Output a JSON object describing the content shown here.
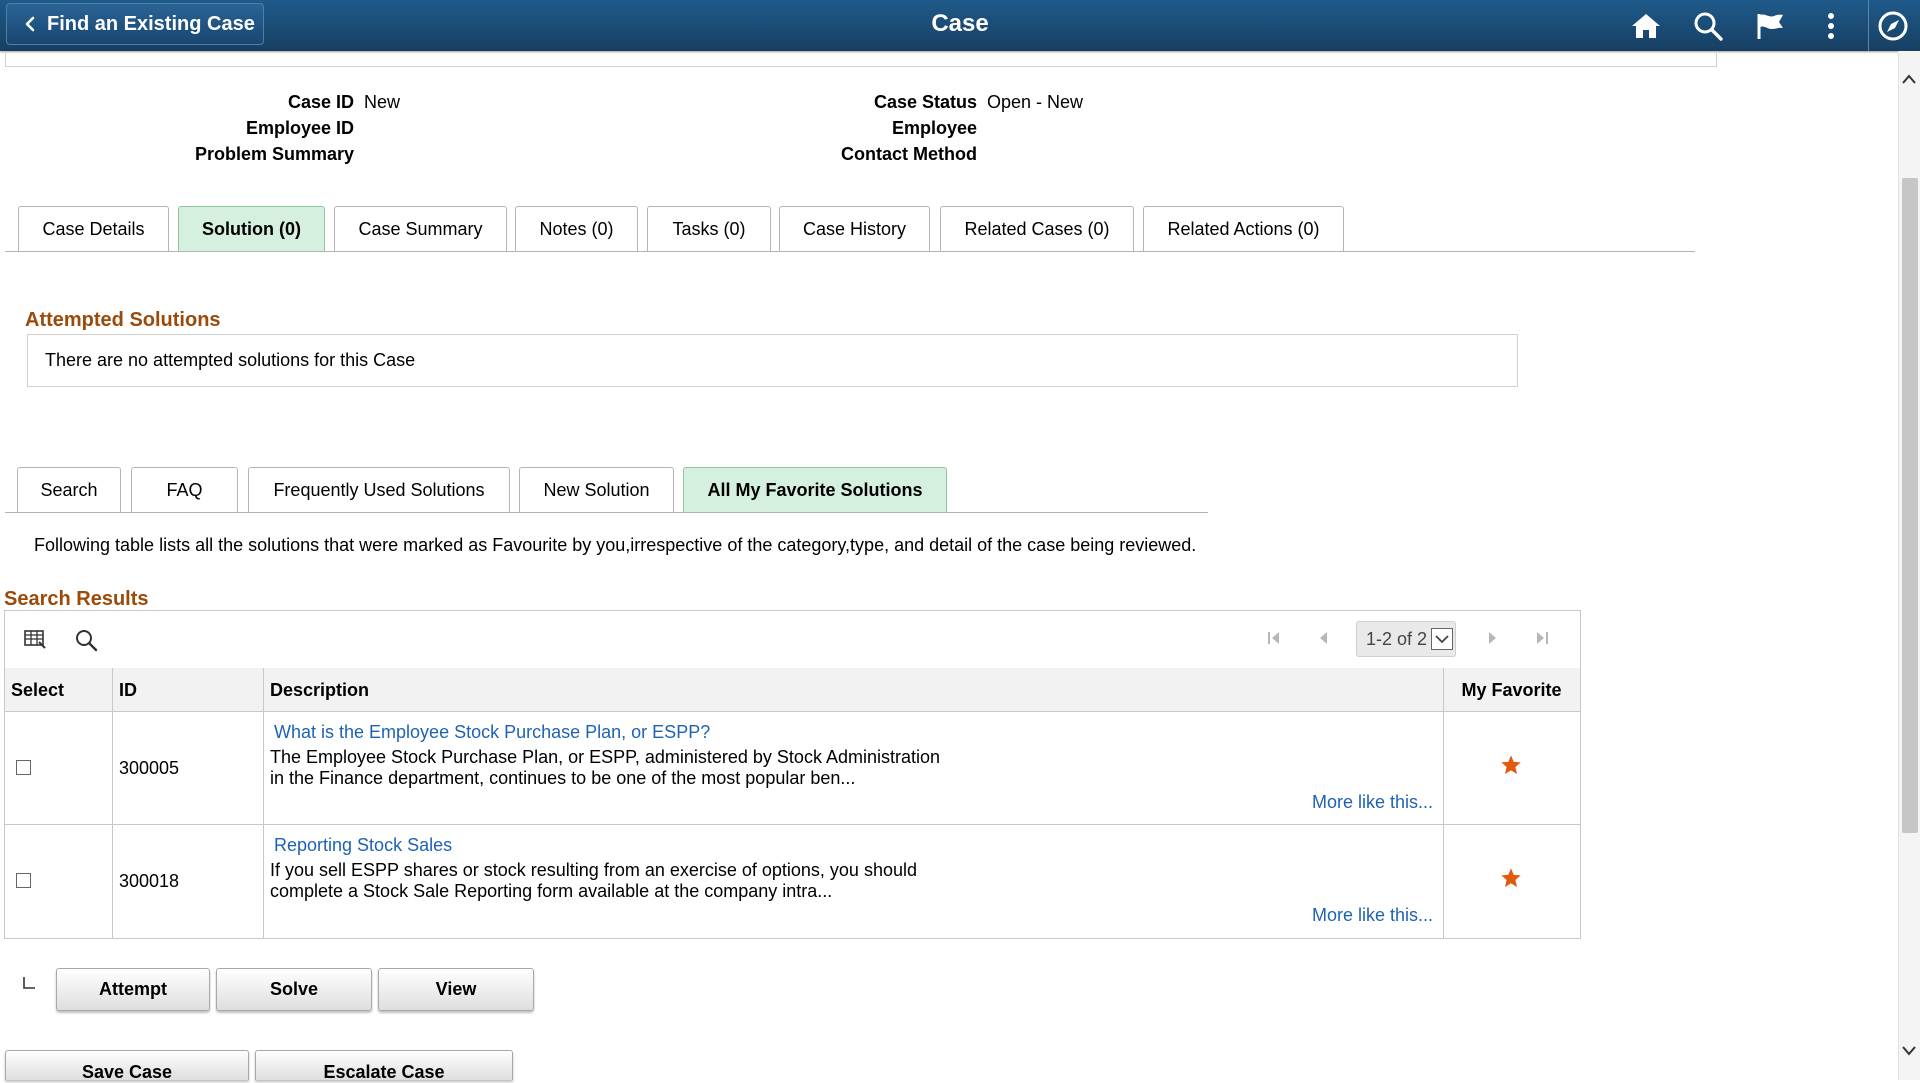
{
  "header": {
    "back_label": "Find an Existing Case",
    "title": "Case",
    "icons": [
      "home-icon",
      "search-icon",
      "flag-icon",
      "more-vertical-icon",
      "navigator-compass-icon"
    ]
  },
  "case_info": {
    "case_id_label": "Case ID",
    "case_id_value": "New",
    "employee_id_label": "Employee ID",
    "problem_summary_label": "Problem Summary",
    "case_status_label": "Case Status",
    "case_status_value": "Open - New",
    "employee_label": "Employee",
    "contact_method_label": "Contact Method"
  },
  "main_tabs": [
    {
      "label": "Case Details",
      "active": false
    },
    {
      "label": "Solution (0)",
      "active": true
    },
    {
      "label": "Case Summary",
      "active": false
    },
    {
      "label": "Notes (0)",
      "active": false
    },
    {
      "label": "Tasks (0)",
      "active": false
    },
    {
      "label": "Case History",
      "active": false
    },
    {
      "label": "Related Cases (0)",
      "active": false
    },
    {
      "label": "Related Actions (0)",
      "active": false
    }
  ],
  "attempted": {
    "title": "Attempted Solutions",
    "message": "There are no attempted solutions for this Case"
  },
  "solution_tabs": [
    {
      "label": "Search",
      "active": false
    },
    {
      "label": "FAQ",
      "active": false
    },
    {
      "label": "Frequently Used Solutions",
      "active": false
    },
    {
      "label": "New Solution",
      "active": false
    },
    {
      "label": "All My Favorite Solutions",
      "active": true
    }
  ],
  "info_text": "Following table lists all the solutions that were marked as Favourite by you,irrespective of the category,type, and detail of the case being reviewed.",
  "results": {
    "title": "Search Results",
    "pager": "1-2 of 2",
    "columns": {
      "select": "Select",
      "id": "ID",
      "description": "Description",
      "favorite": "My Favorite"
    },
    "rows": [
      {
        "id": "300005",
        "title": "What is the Employee Stock Purchase Plan, or ESPP?",
        "line1": "The Employee Stock Purchase Plan, or ESPP, administered by Stock Administration",
        "line2": "in the Finance department, continues to be one of the most popular ben...",
        "more": "More like this..."
      },
      {
        "id": "300018",
        "title": "Reporting Stock Sales",
        "line1": "If you sell ESPP shares or stock resulting from an exercise of options, you should",
        "line2": "complete a Stock Sale Reporting form available at the company intra...",
        "more": "More like this..."
      }
    ]
  },
  "actions": {
    "attempt": "Attempt",
    "solve": "Solve",
    "view": "View"
  },
  "footer": {
    "save": "Save Case",
    "escalate": "Escalate Case"
  },
  "colors": {
    "header": "#1b4a73",
    "accent": "#9c4a0a",
    "link": "#1f62b5",
    "active_tab": "#d6f0df",
    "star": "#e05a10"
  }
}
